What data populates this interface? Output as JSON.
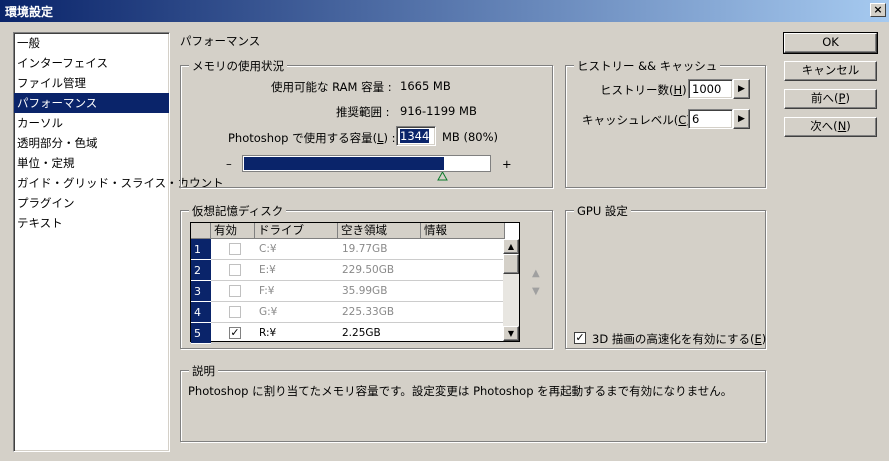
{
  "window": {
    "title": "環境設定",
    "close_label": "×"
  },
  "categories": [
    {
      "label": "一般",
      "selected": false
    },
    {
      "label": "インターフェイス",
      "selected": false
    },
    {
      "label": "ファイル管理",
      "selected": false
    },
    {
      "label": "パフォーマンス",
      "selected": true
    },
    {
      "label": "カーソル",
      "selected": false
    },
    {
      "label": "透明部分・色域",
      "selected": false
    },
    {
      "label": "単位・定規",
      "selected": false
    },
    {
      "label": "ガイド・グリッド・スライス・カウント",
      "selected": false
    },
    {
      "label": "プラグイン",
      "selected": false
    },
    {
      "label": "テキスト",
      "selected": false
    }
  ],
  "section_title": "パフォーマンス",
  "memory": {
    "group_label": "メモリの使用状況",
    "available_label": "使用可能な RAM 容量 :",
    "available_value": "1665 MB",
    "recommended_label": "推奨範囲 :",
    "recommended_value": "916-1199 MB",
    "use_label_pre": "Photoshop で使用する容量(",
    "use_label_key": "L",
    "use_label_post": ") :",
    "use_value": "1344",
    "use_unit": "MB (80%)",
    "slider_minus": "–",
    "slider_plus": "+",
    "slider_fraction": 0.81
  },
  "history": {
    "group_label": "ヒストリー && キャッシュ",
    "states_label_pre": "ヒストリー数(",
    "states_label_key": "H",
    "states_label_post": ") :",
    "states_value": "1000",
    "cache_label_pre": "キャッシュレベル(",
    "cache_label_key": "C",
    "cache_label_post": ") :",
    "cache_value": "6",
    "spin_arrow": "▶"
  },
  "scratch": {
    "group_label": "仮想記憶ディスク",
    "headers": [
      "有効",
      "ドライブ",
      "空き領域",
      "情報"
    ],
    "rows": [
      {
        "num": "1",
        "checked": false,
        "drive": "C:¥",
        "free": "19.77GB",
        "disabled": true
      },
      {
        "num": "2",
        "checked": false,
        "drive": "E:¥",
        "free": "229.50GB",
        "disabled": true
      },
      {
        "num": "3",
        "checked": false,
        "drive": "F:¥",
        "free": "35.99GB",
        "disabled": true
      },
      {
        "num": "4",
        "checked": false,
        "drive": "G:¥",
        "free": "225.33GB",
        "disabled": true
      },
      {
        "num": "5",
        "checked": true,
        "drive": "R:¥",
        "free": "2.25GB",
        "disabled": false
      }
    ],
    "up_arrow": "▲",
    "down_arrow": "▼",
    "scroll_up": "▲",
    "scroll_down": "▼"
  },
  "gpu": {
    "group_label": "GPU 設定",
    "checkbox_label_pre": "3D 描画の高速化を有効にする(",
    "checkbox_label_key": "E",
    "checkbox_label_post": ")",
    "checked": true,
    "check_mark": "✓"
  },
  "description": {
    "group_label": "説明",
    "text": "Photoshop に割り当てたメモリ容量です。設定変更は Photoshop を再起動するまで有効になりません。"
  },
  "buttons": {
    "ok": "OK",
    "cancel": "キャンセル",
    "prev_pre": "前へ(",
    "prev_key": "P",
    "prev_post": ")",
    "next_pre": "次へ(",
    "next_key": "N",
    "next_post": ")"
  }
}
